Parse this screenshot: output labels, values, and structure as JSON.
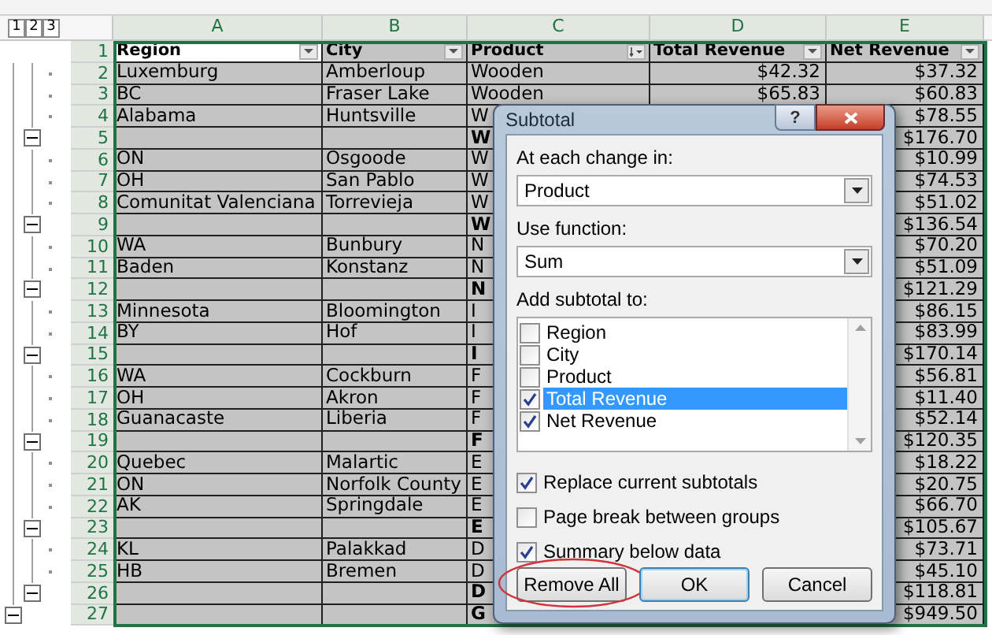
{
  "outline_levels": [
    {
      "label": "1"
    },
    {
      "label": "2"
    },
    {
      "label": "3"
    }
  ],
  "columns": [
    "A",
    "B",
    "C",
    "D",
    "E"
  ],
  "rows": [
    {
      "number": "1",
      "kind": "header",
      "cells": {
        "a": "Region",
        "b": "City",
        "c": "Product",
        "d": "Total Revenue",
        "e": "Net Revenue"
      }
    },
    {
      "number": "2",
      "kind": "detail",
      "cells": {
        "a": "Luxemburg",
        "b": "Amberloup",
        "c": "Wooden",
        "d": "$42.32",
        "e": "$37.32"
      }
    },
    {
      "number": "3",
      "kind": "detail",
      "cells": {
        "a": "BC",
        "b": "Fraser Lake",
        "c": "Wooden",
        "d": "$65.83",
        "e": "$60.83"
      }
    },
    {
      "number": "4",
      "kind": "detail",
      "cells": {
        "a": "Alabama",
        "b": "Huntsville",
        "c": "W",
        "e": "$78.55"
      }
    },
    {
      "number": "5",
      "kind": "subtotal",
      "cells": {
        "c": "W",
        "e": "$176.70"
      }
    },
    {
      "number": "6",
      "kind": "detail",
      "cells": {
        "a": "ON",
        "b": "Osgoode",
        "c": "W",
        "e": "$10.99"
      }
    },
    {
      "number": "7",
      "kind": "detail",
      "cells": {
        "a": "OH",
        "b": "San Pablo",
        "c": "W",
        "e": "$74.53"
      }
    },
    {
      "number": "8",
      "kind": "detail",
      "cells": {
        "a": "Comunitat Valenciana",
        "b": "Torrevieja",
        "c": "W",
        "e": "$51.02"
      }
    },
    {
      "number": "9",
      "kind": "subtotal",
      "cells": {
        "c": "W",
        "e": "$136.54"
      }
    },
    {
      "number": "10",
      "kind": "detail",
      "cells": {
        "a": "WA",
        "b": "Bunbury",
        "c": "N",
        "e": "$70.20"
      }
    },
    {
      "number": "11",
      "kind": "detail",
      "cells": {
        "a": "Baden",
        "b": "Konstanz",
        "c": "N",
        "e": "$51.09"
      }
    },
    {
      "number": "12",
      "kind": "subtotal",
      "cells": {
        "c": "N",
        "e": "$121.29"
      }
    },
    {
      "number": "13",
      "kind": "detail",
      "cells": {
        "a": "Minnesota",
        "b": "Bloomington",
        "c": "I",
        "e": "$86.15"
      }
    },
    {
      "number": "14",
      "kind": "detail",
      "cells": {
        "a": "BY",
        "b": "Hof",
        "c": "I",
        "e": "$83.99"
      }
    },
    {
      "number": "15",
      "kind": "subtotal",
      "cells": {
        "c": "I",
        "e": "$170.14"
      }
    },
    {
      "number": "16",
      "kind": "detail",
      "cells": {
        "a": "WA",
        "b": "Cockburn",
        "c": "F",
        "e": "$56.81"
      }
    },
    {
      "number": "17",
      "kind": "detail",
      "cells": {
        "a": "OH",
        "b": "Akron",
        "c": "F",
        "e": "$11.40"
      }
    },
    {
      "number": "18",
      "kind": "detail",
      "cells": {
        "a": "Guanacaste",
        "b": "Liberia",
        "c": "F",
        "e": "$52.14"
      }
    },
    {
      "number": "19",
      "kind": "subtotal",
      "cells": {
        "c": "F",
        "e": "$120.35"
      }
    },
    {
      "number": "20",
      "kind": "detail",
      "cells": {
        "a": "Quebec",
        "b": "Malartic",
        "c": "E",
        "e": "$18.22"
      }
    },
    {
      "number": "21",
      "kind": "detail",
      "cells": {
        "a": "ON",
        "b": "Norfolk County",
        "c": "E",
        "e": "$20.75"
      }
    },
    {
      "number": "22",
      "kind": "detail",
      "cells": {
        "a": "AK",
        "b": "Springdale",
        "c": "E",
        "e": "$66.70"
      }
    },
    {
      "number": "23",
      "kind": "subtotal",
      "cells": {
        "c": "E",
        "e": "$105.67"
      }
    },
    {
      "number": "24",
      "kind": "detail",
      "cells": {
        "a": "KL",
        "b": "Palakkad",
        "c": "D",
        "e": "$73.71"
      }
    },
    {
      "number": "25",
      "kind": "detail",
      "cells": {
        "a": "HB",
        "b": "Bremen",
        "c": "D",
        "e": "$45.10"
      }
    },
    {
      "number": "26",
      "kind": "subtotal",
      "cells": {
        "c": "D",
        "e": "$118.81"
      }
    },
    {
      "number": "27",
      "kind": "grand_total",
      "cells": {
        "c": "G",
        "e": "$949.50"
      }
    }
  ],
  "dialog": {
    "title": "Subtotal",
    "help_label": "?",
    "at_each_change": {
      "label": "At each change in:",
      "value": "Product"
    },
    "use_function": {
      "label": "Use function:",
      "value": "Sum"
    },
    "add_subtotal": {
      "label": "Add subtotal to:",
      "items": [
        {
          "label": "Region",
          "checked": false,
          "selected": false
        },
        {
          "label": "City",
          "checked": false,
          "selected": false
        },
        {
          "label": "Product",
          "checked": false,
          "selected": false
        },
        {
          "label": "Total Revenue",
          "checked": true,
          "selected": true
        },
        {
          "label": "Net Revenue",
          "checked": true,
          "selected": false
        }
      ]
    },
    "options": [
      {
        "label": "Replace current subtotals",
        "checked": true
      },
      {
        "label": "Page break between groups",
        "checked": false
      },
      {
        "label": "Summary below data",
        "checked": true
      }
    ],
    "buttons": [
      {
        "label": "Remove All",
        "default": false,
        "circled": true
      },
      {
        "label": "OK",
        "default": true,
        "circled": false
      },
      {
        "label": "Cancel",
        "default": false,
        "circled": false
      }
    ]
  }
}
